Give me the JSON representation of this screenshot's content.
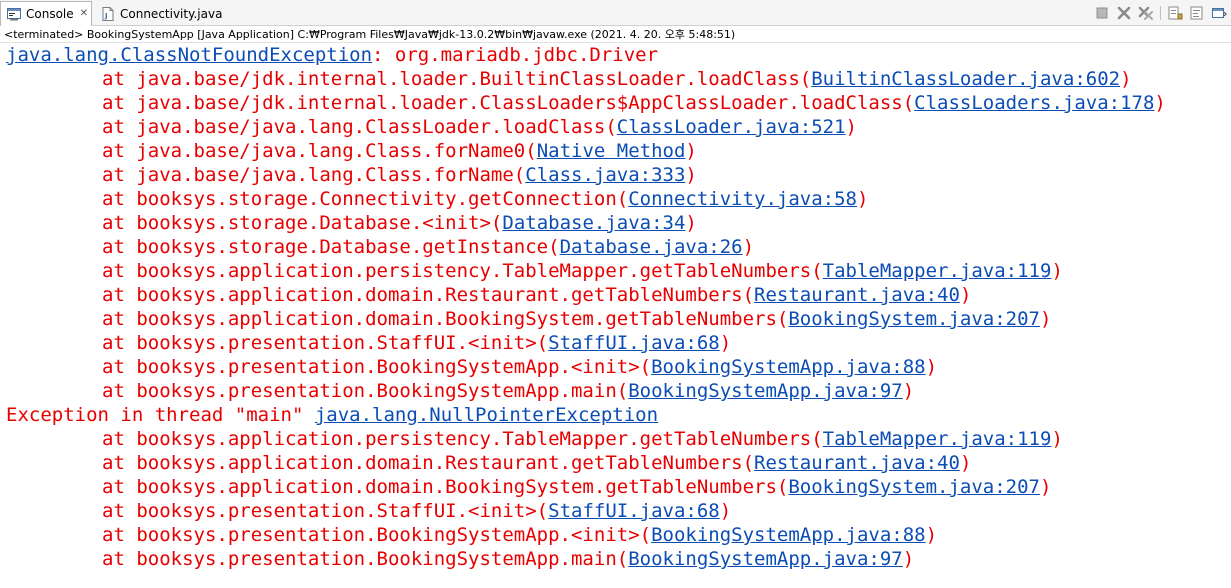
{
  "tabs": [
    {
      "label": "Console",
      "icon": "console-icon",
      "active": true
    },
    {
      "label": "Connectivity.java",
      "icon": "java-file-icon",
      "active": false
    }
  ],
  "toolbar": [
    "terminate-icon",
    "remove-launch-icon",
    "remove-all-terminated-icon",
    "scroll-lock-icon",
    "word-wrap-icon",
    "show-console-icon"
  ],
  "status_text": "<terminated> BookingSystemApp [Java Application] C:₩Program Files₩Java₩jdk-13.0.2₩bin₩javaw.exe (2021. 4. 20. 오후 5:48:51)",
  "colors": {
    "error_text": "#e80000",
    "link": "#0b4db5"
  },
  "console": {
    "lines": [
      {
        "indent": false,
        "pre": "",
        "link": "java.lang.ClassNotFoundException",
        "post": ": org.mariadb.jdbc.Driver"
      },
      {
        "indent": true,
        "pre": "at java.base/jdk.internal.loader.BuiltinClassLoader.loadClass(",
        "link": "BuiltinClassLoader.java:602",
        "post": ")"
      },
      {
        "indent": true,
        "pre": "at java.base/jdk.internal.loader.ClassLoaders$AppClassLoader.loadClass(",
        "link": "ClassLoaders.java:178",
        "post": ")"
      },
      {
        "indent": true,
        "pre": "at java.base/java.lang.ClassLoader.loadClass(",
        "link": "ClassLoader.java:521",
        "post": ")"
      },
      {
        "indent": true,
        "pre": "at java.base/java.lang.Class.forName0(",
        "link": "Native Method",
        "post": ")"
      },
      {
        "indent": true,
        "pre": "at java.base/java.lang.Class.forName(",
        "link": "Class.java:333",
        "post": ")"
      },
      {
        "indent": true,
        "pre": "at booksys.storage.Connectivity.getConnection(",
        "link": "Connectivity.java:58",
        "post": ")"
      },
      {
        "indent": true,
        "pre": "at booksys.storage.Database.<init>(",
        "link": "Database.java:34",
        "post": ")"
      },
      {
        "indent": true,
        "pre": "at booksys.storage.Database.getInstance(",
        "link": "Database.java:26",
        "post": ")"
      },
      {
        "indent": true,
        "pre": "at booksys.application.persistency.TableMapper.getTableNumbers(",
        "link": "TableMapper.java:119",
        "post": ")"
      },
      {
        "indent": true,
        "pre": "at booksys.application.domain.Restaurant.getTableNumbers(",
        "link": "Restaurant.java:40",
        "post": ")"
      },
      {
        "indent": true,
        "pre": "at booksys.application.domain.BookingSystem.getTableNumbers(",
        "link": "BookingSystem.java:207",
        "post": ")"
      },
      {
        "indent": true,
        "pre": "at booksys.presentation.StaffUI.<init>(",
        "link": "StaffUI.java:68",
        "post": ")"
      },
      {
        "indent": true,
        "pre": "at booksys.presentation.BookingSystemApp.<init>(",
        "link": "BookingSystemApp.java:88",
        "post": ")"
      },
      {
        "indent": true,
        "pre": "at booksys.presentation.BookingSystemApp.main(",
        "link": "BookingSystemApp.java:97",
        "post": ")"
      },
      {
        "indent": false,
        "pre": "Exception in thread \"main\" ",
        "link": "java.lang.NullPointerException",
        "post": ""
      },
      {
        "indent": true,
        "pre": "at booksys.application.persistency.TableMapper.getTableNumbers(",
        "link": "TableMapper.java:119",
        "post": ")"
      },
      {
        "indent": true,
        "pre": "at booksys.application.domain.Restaurant.getTableNumbers(",
        "link": "Restaurant.java:40",
        "post": ")"
      },
      {
        "indent": true,
        "pre": "at booksys.application.domain.BookingSystem.getTableNumbers(",
        "link": "BookingSystem.java:207",
        "post": ")"
      },
      {
        "indent": true,
        "pre": "at booksys.presentation.StaffUI.<init>(",
        "link": "StaffUI.java:68",
        "post": ")"
      },
      {
        "indent": true,
        "pre": "at booksys.presentation.BookingSystemApp.<init>(",
        "link": "BookingSystemApp.java:88",
        "post": ")"
      },
      {
        "indent": true,
        "pre": "at booksys.presentation.BookingSystemApp.main(",
        "link": "BookingSystemApp.java:97",
        "post": ")"
      }
    ]
  }
}
